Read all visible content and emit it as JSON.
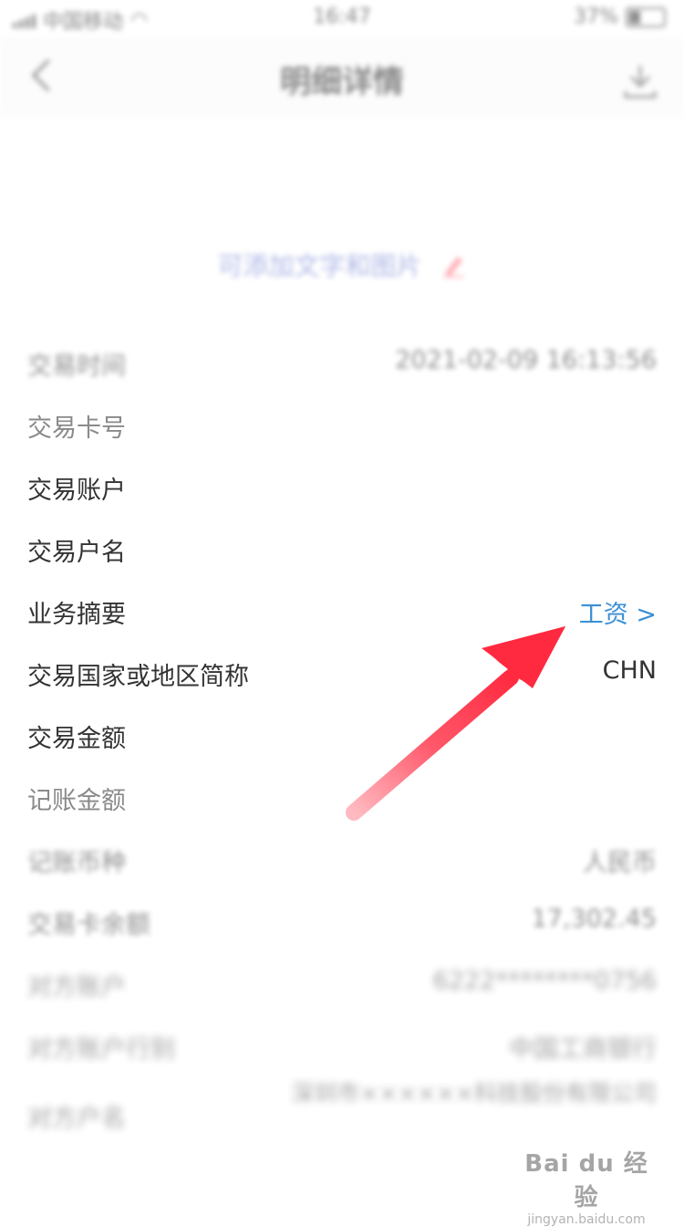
{
  "status_bar": {
    "carrier": "中国移动",
    "time": "16:47",
    "battery": "37%"
  },
  "nav": {
    "title": "明细详情",
    "back_icon": "chevron-left-icon",
    "download_icon": "download-icon"
  },
  "note": {
    "text": "可添加文字和图片",
    "icon": "pencil-icon"
  },
  "rows": [
    {
      "label": "交易时间",
      "value": "2021-02-09 16:13:56"
    },
    {
      "label": "交易卡号",
      "value": ""
    },
    {
      "label": "交易账户",
      "value": ""
    },
    {
      "label": "交易户名",
      "value": ""
    },
    {
      "label": "业务摘要",
      "value": "工资 >"
    },
    {
      "label": "交易国家或地区简称",
      "value": "CHN"
    },
    {
      "label": "交易金额",
      "value": ""
    },
    {
      "label": "记账金额",
      "value": ""
    },
    {
      "label": "记账币种",
      "value": "人民币"
    },
    {
      "label": "交易卡余额",
      "value": "17,302.45"
    },
    {
      "label": "对方账户",
      "value": "6222********0756"
    },
    {
      "label": "对方账户行别",
      "value": "中国工商银行"
    },
    {
      "label": "对方户名",
      "value": "深圳市××××××科技股份有限公司"
    }
  ],
  "annotation": {
    "arrow_color": "#ff3a4f"
  },
  "watermark": {
    "brand": "Bai du 经验",
    "url": "jingyan.baidu.com"
  }
}
